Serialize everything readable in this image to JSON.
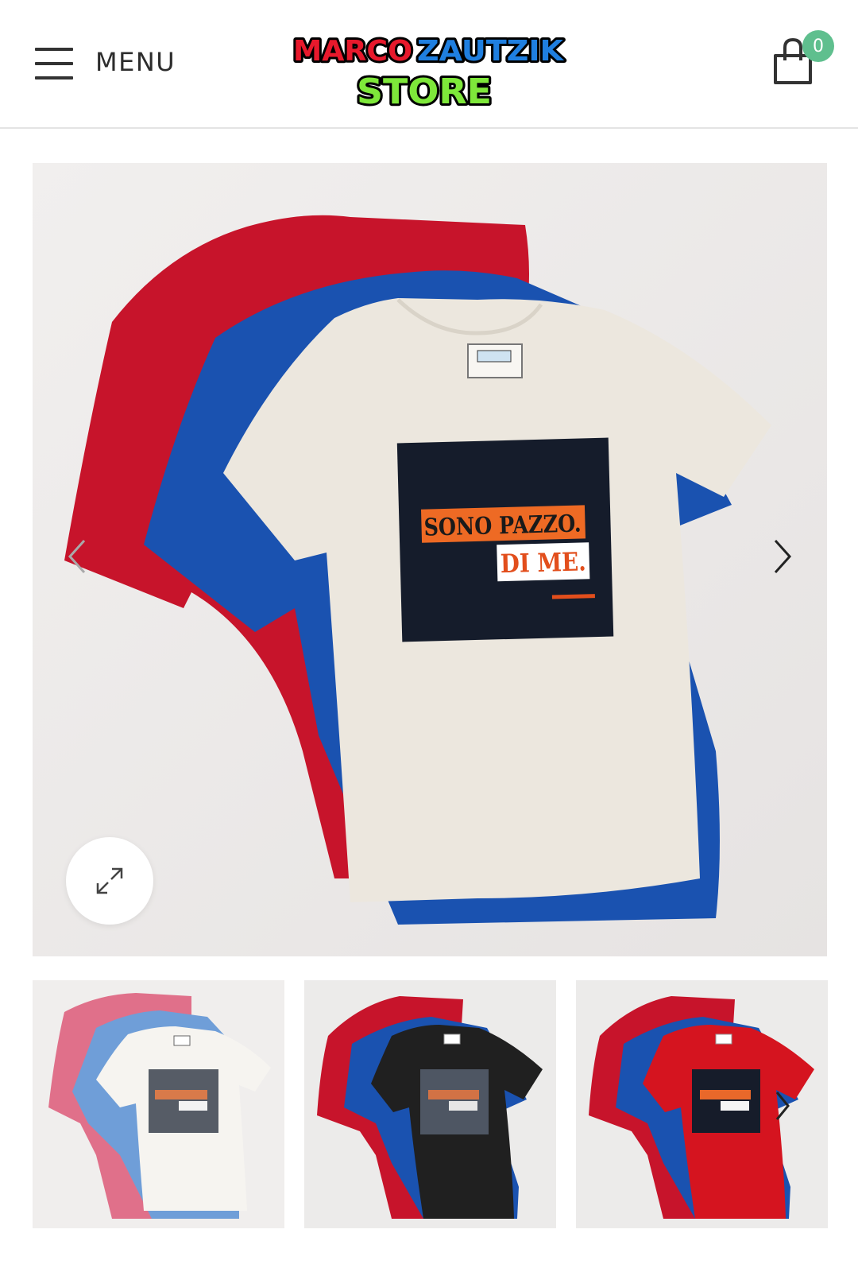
{
  "header": {
    "menu_label": "MENU",
    "logo_line1_a": "MARCO",
    "logo_line1_b": "ZAUTZIK",
    "logo_line2": "STORE",
    "cart_count": "0"
  },
  "product": {
    "print_line1": "SONO PAZZO.",
    "print_line2": "DI ME.",
    "thumbnails": [
      {
        "shirt_color": "cream"
      },
      {
        "shirt_color": "black"
      },
      {
        "shirt_color": "red"
      }
    ]
  },
  "icons": {
    "menu": "hamburger-icon",
    "cart": "shopping-bag-icon",
    "prev": "chevron-left-icon",
    "next": "chevron-right-icon",
    "zoom": "expand-icon"
  },
  "colors": {
    "badge": "#5fbf8e",
    "logo_red": "#e8192c",
    "logo_blue": "#1f7fe0",
    "logo_green": "#7ee83a",
    "shirt_red": "#c7142b",
    "shirt_blue": "#1a52b0",
    "shirt_cream": "#ecE7de",
    "print_orange": "#ee6a24"
  }
}
